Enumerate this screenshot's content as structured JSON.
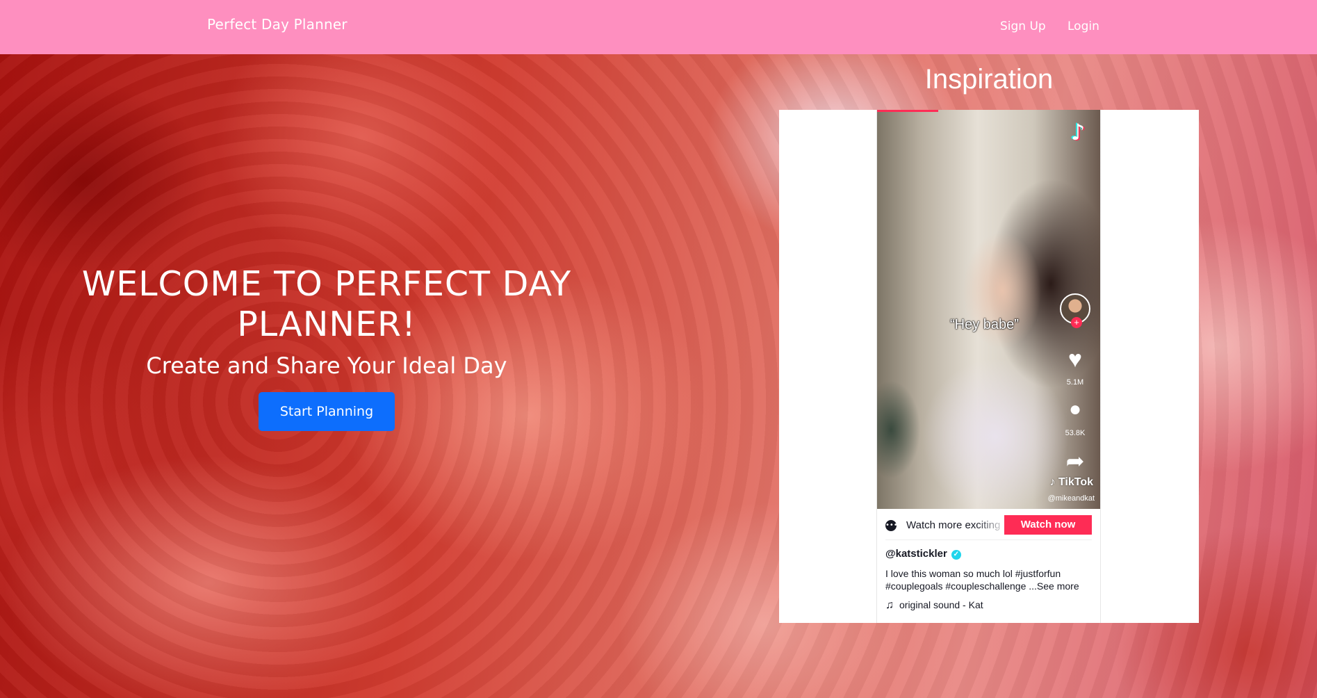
{
  "nav": {
    "brand": "Perfect Day Planner",
    "signup": "Sign Up",
    "login": "Login",
    "bg_color": "#fe8fbf"
  },
  "hero": {
    "title": "WELCOME TO PERFECT DAY PLANNER!",
    "subtitle": "Create and Share Your Ideal Day",
    "cta": "Start Planning",
    "cta_color": "#0d6efd"
  },
  "inspiration": {
    "title": "Inspiration",
    "tiktok": {
      "logo_icon": "tiktok-logo-icon",
      "caption": "“Hey babe”",
      "likes": "5.1M",
      "comments": "53.8K",
      "watermark": "TikTok",
      "watermark_handle": "@mikeandkat",
      "watch_more": "Watch more exciting",
      "watch_now": "Watch now",
      "username": "@katstickler",
      "description": "I love this woman so much lol #justforfun #couplegoals #coupleschallenge ...See more",
      "sound": "original sound - Kat",
      "accent": "#fe2c55"
    }
  }
}
